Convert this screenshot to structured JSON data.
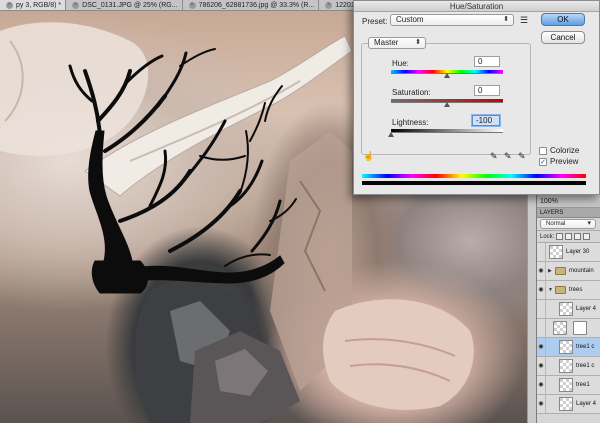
{
  "tabs": [
    {
      "label": "py 3, RGB/8) *",
      "active": true
    },
    {
      "label": "DSC_0131.JPG @ 25% (RG...",
      "active": false
    },
    {
      "label": "786206_62881736.jpg @ 33.3% (R...",
      "active": false
    },
    {
      "label": "1220191_90687846.jpg @ 33...",
      "active": false
    }
  ],
  "dialog": {
    "title": "Hue/Saturation",
    "preset_label": "Preset:",
    "preset_value": "Custom",
    "ok_label": "OK",
    "cancel_label": "Cancel",
    "channel": "Master",
    "hue": {
      "label": "Hue:",
      "value": "0",
      "position": 0.5
    },
    "saturation": {
      "label": "Saturation:",
      "value": "0",
      "position": 0.5
    },
    "lightness": {
      "label": "Lightness:",
      "value": "-100",
      "position": 0.0
    },
    "colorize_label": "Colorize",
    "colorize_checked": false,
    "preview_label": "Preview",
    "preview_checked": true
  },
  "dock": {
    "zoom": "100%",
    "panel_title": "LAYERS",
    "blend_mode": "Normal",
    "lock_label": "Lock:"
  },
  "layers": [
    {
      "name": "Layer 30",
      "type": "layer",
      "visible": false
    },
    {
      "name": "mountain",
      "type": "group",
      "visible": true
    },
    {
      "name": "trees",
      "type": "group",
      "visible": true
    },
    {
      "name": "Layer 4",
      "type": "layer",
      "visible": false
    },
    {
      "name": "",
      "type": "mask",
      "visible": false
    },
    {
      "name": "tree1 c",
      "type": "layer",
      "visible": true,
      "selected": true
    },
    {
      "name": "tree1 c",
      "type": "layer",
      "visible": true
    },
    {
      "name": "tree1",
      "type": "layer",
      "visible": true
    },
    {
      "name": "Layer 4",
      "type": "layer",
      "visible": true
    }
  ],
  "colors": {
    "ok_button": "#5f9ee3",
    "selected_layer": "#aecbf0",
    "tree_silhouette": "#0d0c0c"
  }
}
